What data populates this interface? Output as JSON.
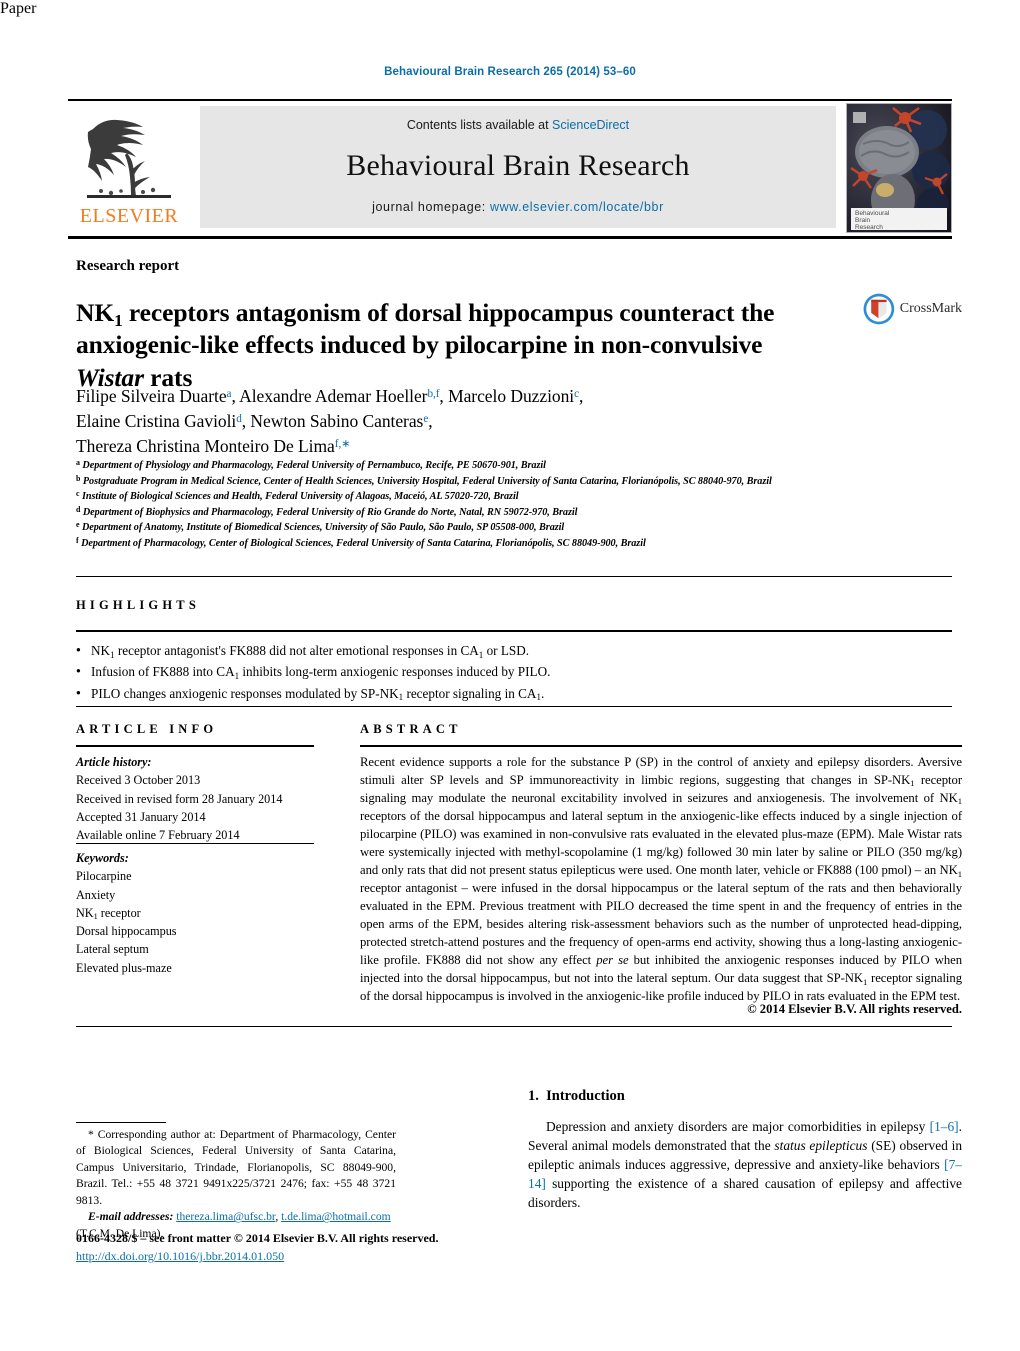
{
  "running_head": "Behavioural Brain Research 265 (2014) 53–60",
  "masthead": {
    "publisher_name": "ELSEVIER",
    "contents_prefix": "Contents lists available at ",
    "contents_link": "ScienceDirect",
    "journal_name": "Behavioural Brain Research",
    "homepage_label": "journal homepage: ",
    "homepage_url": "www.elsevier.com/locate/bbr",
    "cover_title_line1": "Behavioural",
    "cover_title_line2": "Brain",
    "cover_title_line3": "Research"
  },
  "article": {
    "type_label": "Research report",
    "title_part1": "NK",
    "title_sub1": "1",
    "title_part2": " receptors antagonism of dorsal hippocampus counteract the anxiogenic-like effects induced by pilocarpine in non-convulsive ",
    "title_italic": "Wistar",
    "title_part3": " rats",
    "crossmark_label": "CrossMark"
  },
  "authors": [
    {
      "name": "Filipe Silveira Duarte",
      "marks": "a",
      "sep": ", "
    },
    {
      "name": "Alexandre Ademar Hoeller",
      "marks": "b,f",
      "sep": ", "
    },
    {
      "name": "Marcelo Duzzioni",
      "marks": "c",
      "sep": ", "
    },
    {
      "name": "Elaine Cristina Gavioli",
      "marks": "d",
      "sep": ", "
    },
    {
      "name": "Newton Sabino Canteras",
      "marks": "e",
      "sep": ", "
    },
    {
      "name": "Thereza Christina Monteiro De Lima",
      "marks": "f,",
      "sep": ""
    }
  ],
  "affiliations": [
    {
      "mark": "a",
      "text": "Department of Physiology and Pharmacology, Federal University of Pernambuco, Recife, PE 50670-901, Brazil"
    },
    {
      "mark": "b",
      "text": "Postgraduate Program in Medical Science, Center of Health Sciences, University Hospital, Federal University of Santa Catarina, Florianópolis, SC 88040-970, Brazil"
    },
    {
      "mark": "c",
      "text": "Institute of Biological Sciences and Health, Federal University of Alagoas, Maceió, AL 57020-720, Brazil"
    },
    {
      "mark": "d",
      "text": "Department of Biophysics and Pharmacology, Federal University of Rio Grande do Norte, Natal, RN 59072-970, Brazil"
    },
    {
      "mark": "e",
      "text": "Department of Anatomy, Institute of Biomedical Sciences, University of São Paulo, São Paulo, SP 05508-000, Brazil"
    },
    {
      "mark": "f",
      "text": "Department of Pharmacology, Center of Biological Sciences, Federal University of Santa Catarina, Florianópolis, SC 88049-900, Brazil"
    }
  ],
  "highlights": {
    "heading": "HIGHLIGHTS",
    "items": [
      "NK1 receptor antagonist's FK888 did not alter emotional responses in CA1 or LSD.",
      "Infusion of FK888 into CA1 inhibits long-term anxiogenic responses induced by PILO.",
      "PILO changes anxiogenic responses modulated by SP-NK1 receptor signaling in CA1."
    ]
  },
  "article_info": {
    "heading": "ARTICLE INFO",
    "history_label": "Article history:",
    "history": [
      "Received 3 October 2013",
      "Received in revised form 28 January 2014",
      "Accepted 31 January 2014",
      "Available online 7 February 2014"
    ],
    "keywords_label": "Keywords:",
    "keywords": [
      "Pilocarpine",
      "Anxiety",
      "NK1 receptor",
      "Dorsal hippocampus",
      "Lateral septum",
      "Elevated plus-maze"
    ]
  },
  "abstract": {
    "heading": "ABSTRACT",
    "text": "Recent evidence supports a role for the substance P (SP) in the control of anxiety and epilepsy disorders. Aversive stimuli alter SP levels and SP immunoreactivity in limbic regions, suggesting that changes in SP-NK1 receptor signaling may modulate the neuronal excitability involved in seizures and anxiogenesis. The involvement of NK1 receptors of the dorsal hippocampus and lateral septum in the anxiogenic-like effects induced by a single injection of pilocarpine (PILO) was examined in non-convulsive rats evaluated in the elevated plus-maze (EPM). Male Wistar rats were systemically injected with methyl-scopolamine (1 mg/kg) followed 30 min later by saline or PILO (350 mg/kg) and only rats that did not present status epilepticus were used. One month later, vehicle or FK888 (100 pmol) – an NK1 receptor antagonist – were infused in the dorsal hippocampus or the lateral septum of the rats and then behaviorally evaluated in the EPM. Previous treatment with PILO decreased the time spent in and the frequency of entries in the open arms of the EPM, besides altering risk-assessment behaviors such as the number of unprotected head-dipping, protected stretch-attend postures and the frequency of open-arms end activity, showing thus a long-lasting anxiogenic-like profile. FK888 did not show any effect per se but inhibited the anxiogenic responses induced by PILO when injected into the dorsal hippocampus, but not into the lateral septum. Our data suggest that SP-NK1 receptor signaling of the dorsal hippocampus is involved in the anxiogenic-like profile induced by PILO in rats evaluated in the EPM test.",
    "copyright": "© 2014 Elsevier B.V. All rights reserved."
  },
  "footer": {
    "corresponding_marker": "*",
    "corresponding_text": "Corresponding author at: Department of Pharmacology, Center of Biological Sciences, Federal University of Santa Catarina, Campus Universitario, Trindade, Florianopolis, SC 88049-900, Brazil. Tel.: +55 48 3721 9491x225/3721 2476; fax: +55 48 3721 9813.",
    "email_label": "E-mail addresses:",
    "email_1": "thereza.lima@ufsc.br",
    "email_2": "t.de.lima@hotmail.com",
    "email_owner": "(T.C.M. De Lima).",
    "frontmatter": "0166-4328/$ – see front matter © 2014 Elsevier B.V. All rights reserved.",
    "doi": "http://dx.doi.org/10.1016/j.bbr.2014.01.050"
  },
  "introduction": {
    "number": "1.",
    "heading": "Introduction",
    "paragraph_1_a": "Depression and anxiety disorders are major comorbidities in epilepsy ",
    "ref_1": "[1–6]",
    "paragraph_1_b": ". Several animal models demonstrated that the ",
    "italic_1": "status epilepticus",
    "paragraph_1_c": " (SE) observed in epileptic animals induces aggressive, depressive and anxiety-like behaviors ",
    "ref_2": "[7–14]",
    "paragraph_1_d": " supporting the existence of a shared causation of epilepsy and affective disorders."
  },
  "colors": {
    "link": "#0b6ea8",
    "elsevier_orange": "#f47b20",
    "masthead_bg": "#e6e6e6"
  }
}
